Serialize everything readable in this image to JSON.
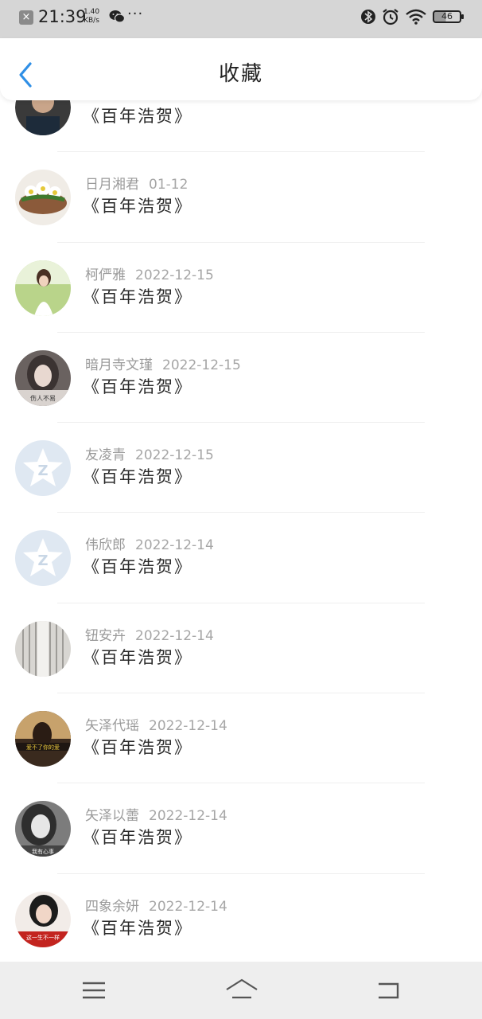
{
  "status_bar": {
    "time": "21:39",
    "speed_value": "1.40",
    "speed_unit": "KB/s",
    "more": "···",
    "battery": "46",
    "icons": [
      "close-notification-icon",
      "wechat-icon",
      "bluetooth-icon",
      "alarm-icon",
      "wifi-icon",
      "battery-icon"
    ]
  },
  "header": {
    "title": "收藏",
    "back_icon": "chevron-left-icon"
  },
  "list": {
    "items": [
      {
        "name": "",
        "date": "",
        "title": "《百年浩贺》",
        "avatar": "photo-person"
      },
      {
        "name": "日月湘君",
        "date": "01-12",
        "title": "《百年浩贺》",
        "avatar": "photo-flowers"
      },
      {
        "name": "柯俨雅",
        "date": "2022-12-15",
        "title": "《百年浩贺》",
        "avatar": "photo-girl"
      },
      {
        "name": "暗月寺文瑾",
        "date": "2022-12-15",
        "title": "《百年浩贺》",
        "avatar": "photo-girl-dark"
      },
      {
        "name": "友凌青",
        "date": "2022-12-15",
        "title": "《百年浩贺》",
        "avatar": "qzone-default"
      },
      {
        "name": "伟欣郎",
        "date": "2022-12-14",
        "title": "《百年浩贺》",
        "avatar": "qzone-default"
      },
      {
        "name": "钮安卉",
        "date": "2022-12-14",
        "title": "《百年浩贺》",
        "avatar": "photo-curtain"
      },
      {
        "name": "矢泽代瑶",
        "date": "2022-12-14",
        "title": "《百年浩贺》",
        "avatar": "photo-sunset"
      },
      {
        "name": "矢泽以蕾",
        "date": "2022-12-14",
        "title": "《百年浩贺》",
        "avatar": "photo-girl-bw"
      },
      {
        "name": "四象余妍",
        "date": "2022-12-14",
        "title": "《百年浩贺》",
        "avatar": "photo-girl-red"
      }
    ]
  },
  "nav_bar": {
    "menu_icon": "menu-icon",
    "home_icon": "home-icon",
    "back_icon": "back-icon"
  },
  "colors": {
    "status_bar_bg": "#d6d6d6",
    "accent_blue": "#2f8fe6",
    "nav_bar_bg": "#eeeeee"
  }
}
